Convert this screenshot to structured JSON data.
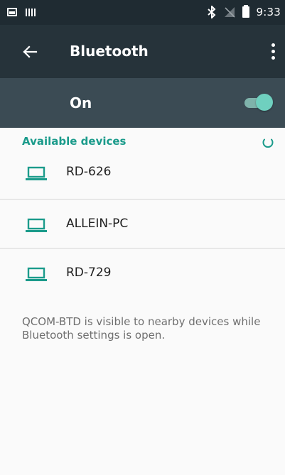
{
  "status_bar": {
    "time": "9:33",
    "icons": [
      "gallery-icon",
      "barcode-icon",
      "bluetooth-icon",
      "no-signal-icon",
      "battery-icon"
    ]
  },
  "app_bar": {
    "title": "Bluetooth"
  },
  "master_switch": {
    "label": "On",
    "state": "on"
  },
  "section": {
    "title": "Available devices"
  },
  "devices": [
    {
      "name": "RD-626"
    },
    {
      "name": "ALLEIN-PC"
    },
    {
      "name": "RD-729"
    }
  ],
  "footer": {
    "visibility_text": "QCOM-BTD is visible to nearby devices while Bluetooth settings is open."
  },
  "colors": {
    "status_bar": "#1f2b32",
    "app_bar": "#26333a",
    "switch_bar": "#3b4b54",
    "accent": "#1b9b8b",
    "background": "#fafafa"
  }
}
